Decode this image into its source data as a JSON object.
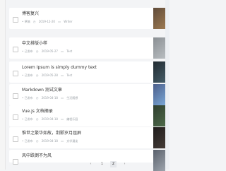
{
  "posts": [
    {
      "title": "博客复兴",
      "status": "• 草稿",
      "date": "2019-12-20",
      "category": "Writer",
      "thumb_colors": [
        "#5f4b3a",
        "#9d7a52"
      ]
    },
    {
      "title": "中文排版小样",
      "status": "• 已发布",
      "date": "2019-05-27",
      "category": "Test",
      "thumb_colors": [
        "#8a8f93",
        "#b9bec2"
      ]
    },
    {
      "title": "Lorem Ipsum is simply dummy text",
      "status": "• 已发布",
      "date": "2019-05-28",
      "category": "Test",
      "thumb_colors": [
        "#202a30",
        "#445c68"
      ]
    },
    {
      "title": "Markdown 测试文章",
      "status": "• 已发布",
      "date": "2019-04-18",
      "category": "生活随想",
      "thumb_colors": [
        "#4b5e8a",
        "#7aa7d6"
      ]
    },
    {
      "title": "Vue.js 文档摘录",
      "status": "• 已发布",
      "date": "2019-04-18",
      "category": "编程乐园",
      "thumb_colors": [
        "#2f3e2f",
        "#4d6a4a"
      ]
    },
    {
      "title": "惟世之繁华如故，荆邯岁月屈屏",
      "status": "• 已发布",
      "date": "2019-04-18",
      "category": "文学漫谈",
      "thumb_colors": [
        "#1f1c1c",
        "#443b37"
      ]
    },
    {
      "title": "风中跌倒不为风",
      "status": "",
      "date": "",
      "category": "",
      "thumb_colors": [
        "#59606b",
        "#9da4ad"
      ]
    }
  ],
  "pagination": {
    "prev": "‹",
    "page1": "1",
    "page2": "2",
    "next": "›"
  },
  "colors": {
    "background": "#f3f4f6",
    "card": "#ffffff",
    "meta_text": "#9aa0a6",
    "title_text": "#333333"
  }
}
